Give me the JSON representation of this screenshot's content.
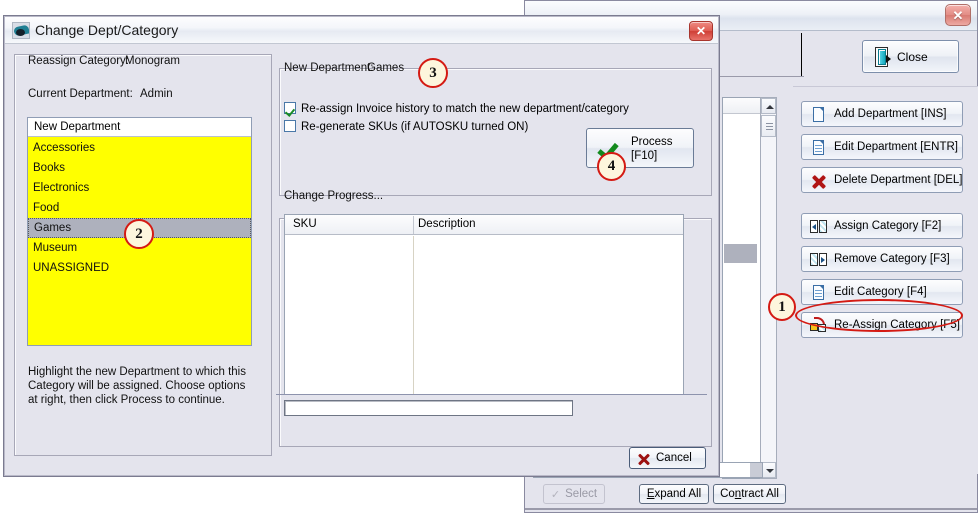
{
  "background_window": {
    "close_button_label": "Close",
    "close_icon": "door-exit-icon",
    "window_close_icon": "close-icon",
    "side_buttons": [
      {
        "label": "Add Department [INS]",
        "icon": "new-document-icon"
      },
      {
        "label": "Edit Department [ENTR]",
        "icon": "edit-document-icon"
      },
      {
        "label": "Delete Department [DEL]",
        "icon": "red-x-icon"
      },
      {
        "label": "Assign Category [F2]",
        "icon": "assign-panes-icon"
      },
      {
        "label": "Remove Category [F3]",
        "icon": "remove-panes-icon"
      },
      {
        "label": "Edit Category [F4]",
        "icon": "edit-document-icon"
      },
      {
        "label": "Re-Assign Category [F5]",
        "icon": "reassign-cubes-icon"
      }
    ],
    "bottom_bar": {
      "select_label": "Select",
      "select_icon": "checkmark-icon",
      "expand_all": {
        "prefix": "",
        "accel": "E",
        "rest": "xpand All"
      },
      "contract_all": {
        "prefix": "Co",
        "accel": "n",
        "rest": "tract All"
      }
    },
    "scrollbar": {
      "up_icon": "chevron-up-icon",
      "down_icon": "chevron-down-icon",
      "thumb": "scrollbar-thumb"
    }
  },
  "dialog": {
    "title": "Change Dept/Category",
    "title_icon": "app-swoosh-icon",
    "close_icon": "close-icon",
    "left_panel": {
      "reassign_category_label": "Reassign Category:",
      "reassign_category_value": "Monogram",
      "current_department_label": "Current Department:",
      "current_department_value": "Admin",
      "list_header": "New Department",
      "departments": [
        "Accessories",
        "Books",
        "Electronics",
        "Food",
        "Games",
        "Museum",
        "UNASSIGNED"
      ],
      "selected_department": "Games",
      "help_text": "Highlight the new Department to which this Category will be assigned.  Choose options at right, then click Process to continue."
    },
    "options_panel": {
      "new_department_label": "New Department:",
      "new_department_value": "Games",
      "checkbox_invoice": {
        "label": "Re-assign Invoice history to match the new department/category",
        "checked": true
      },
      "checkbox_skus": {
        "label": "Re-generate SKUs (if AUTOSKU turned ON)",
        "checked": false
      },
      "process_button": {
        "line1": "Process",
        "line2": "[F10]",
        "icon": "green-check-icon"
      }
    },
    "progress_panel": {
      "title": "Change Progress...",
      "columns": [
        "SKU",
        "Description"
      ],
      "rows": [],
      "progress_value": ""
    },
    "cancel_button": {
      "label": "Cancel",
      "icon": "red-x-icon"
    }
  },
  "callouts": [
    {
      "id": "1",
      "number": "1",
      "target": "Re-Assign Category [F5]"
    },
    {
      "id": "2",
      "number": "2",
      "target": "Games"
    },
    {
      "id": "3",
      "number": "3",
      "target": "New Department: Games"
    },
    {
      "id": "4",
      "number": "4",
      "target": "Process [F10]"
    }
  ],
  "colors": {
    "callout_border": "#d41a13",
    "callout_fill": "#fdf6dd",
    "list_highlight": "#ffff00",
    "selection": "#aeb1bd",
    "window_face": "#e4e4ed"
  }
}
